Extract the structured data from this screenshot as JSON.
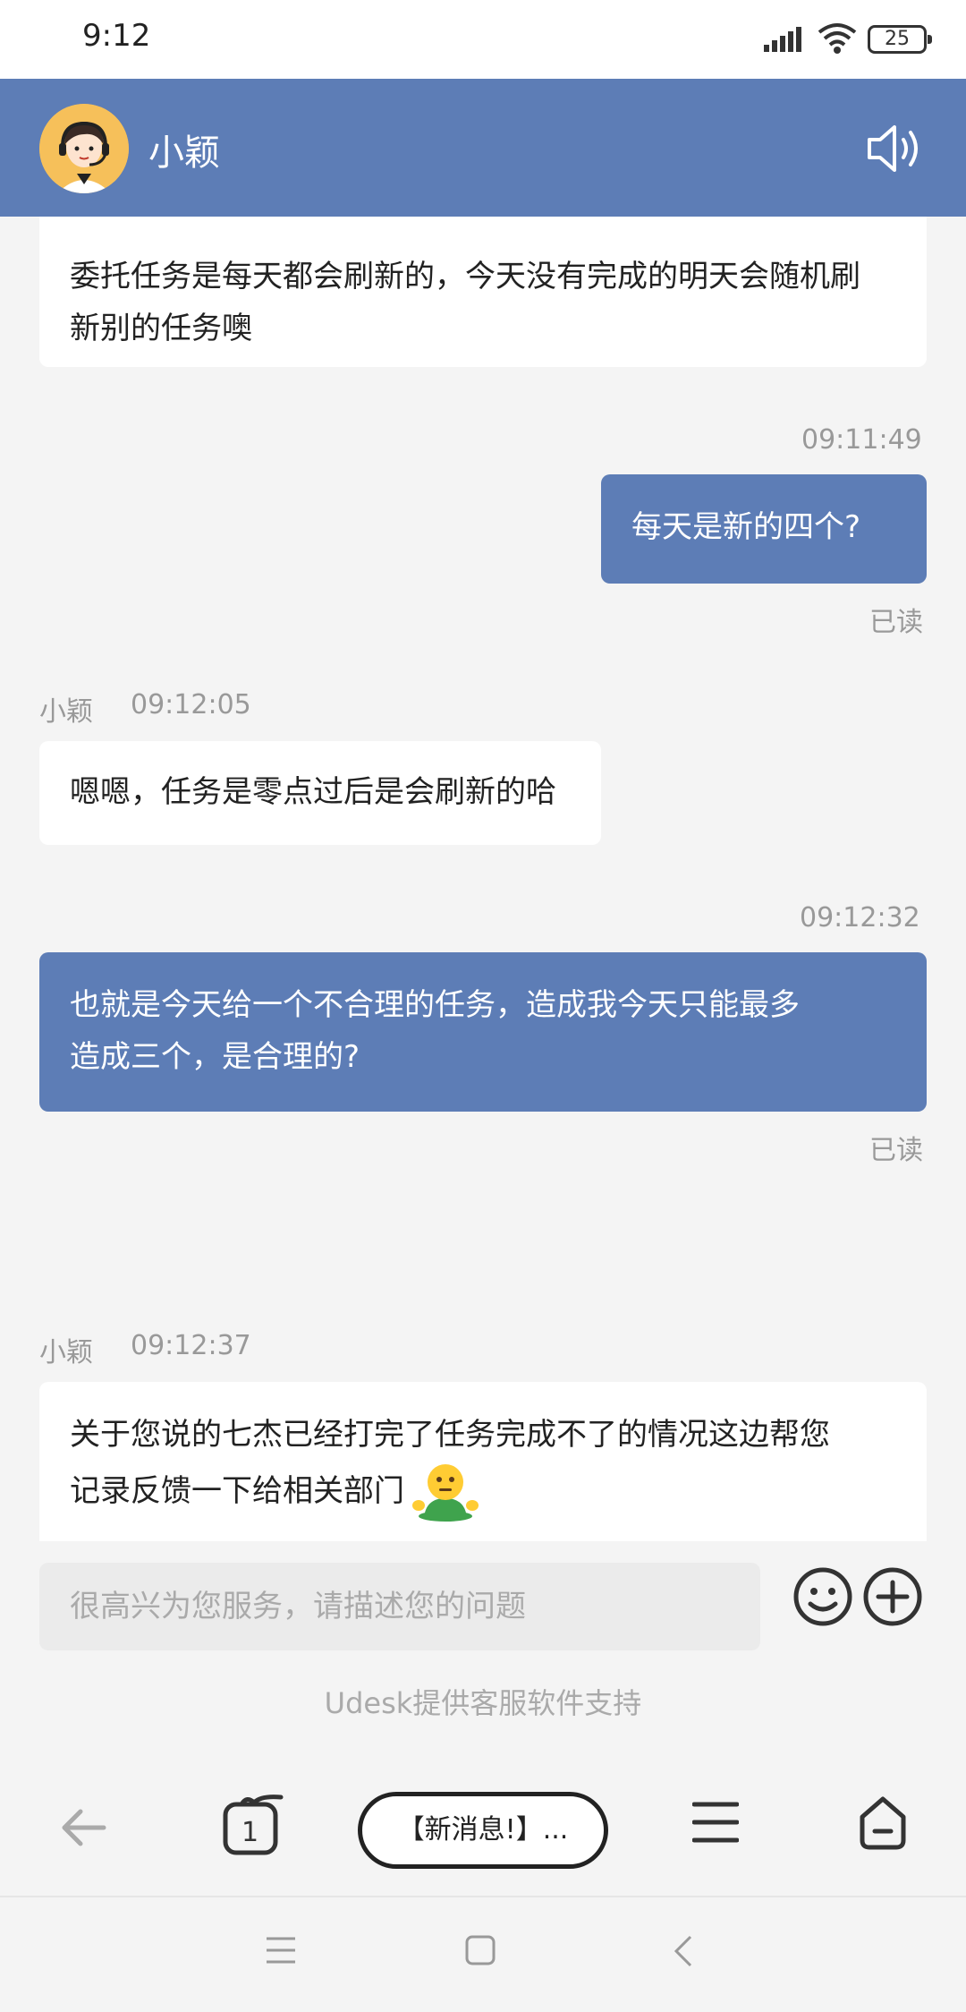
{
  "status_bar": {
    "time": "9:12",
    "battery": "25"
  },
  "header": {
    "agent_name": "小颖"
  },
  "messages": [
    {
      "text_line1": "委托任务是每天都会刷新的，今天没有完成的明天会随机刷",
      "text_line2": "新别的任务噢"
    },
    {
      "time": "09:11:49",
      "text": "每天是新的四个?",
      "read": "已读"
    },
    {
      "sender": "小颖",
      "time": "09:12:05",
      "text": "嗯嗯，任务是零点过后是会刷新的哈"
    },
    {
      "time": "09:12:32",
      "text_line1": "也就是今天给一个不合理的任务，造成我今天只能最多",
      "text_line2": "造成三个，是合理的?",
      "read": "已读"
    },
    {
      "sender": "小颖",
      "time": "09:12:37",
      "text_line1": "关于您说的七杰已经打完了任务完成不了的情况这边帮您",
      "text_line2": "记录反馈一下给相关部门"
    }
  ],
  "composer": {
    "placeholder": "很高兴为您服务，请描述您的问题",
    "powered_by": "Udesk提供客服软件支持"
  },
  "browser_bar": {
    "tab_count": "1",
    "new_message": "【新消息!】..."
  },
  "icons": {
    "signal": "signal-icon",
    "wifi": "wifi-icon",
    "speaker": "speaker-icon",
    "emoji": "emoji-icon",
    "plus": "plus-icon",
    "back": "back-arrow-icon",
    "tabs": "tabs-icon",
    "menu": "menu-icon",
    "home": "home-icon"
  },
  "colors": {
    "header": "#5d7db6",
    "outgoing_bubble": "#5d7db6",
    "background": "#f4f4f4"
  }
}
